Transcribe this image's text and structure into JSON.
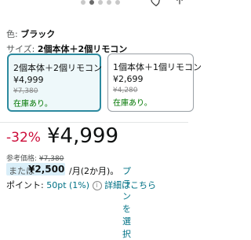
{
  "carousel": {
    "dots": 5,
    "active": 2
  },
  "color": {
    "label": "色:",
    "value": "ブラック"
  },
  "size": {
    "label": "サイズ:",
    "value": "2個本体＋2個リモコン"
  },
  "options": [
    {
      "title": "2個本体＋2個リモコン",
      "price": "¥4,999",
      "original": "¥7,380",
      "stock": "在庫あり。",
      "selected": true
    },
    {
      "title": "1個本体＋1個リモコン",
      "price": "¥2,699",
      "original": "¥4,280",
      "stock": "在庫あり。",
      "selected": false
    }
  ],
  "pricing": {
    "discount": "-32%",
    "yen": "¥",
    "price": "4,999",
    "ref_label": "参考価格:",
    "ref_price": "¥7,380",
    "alt_or": "または",
    "alt_amount": "¥2,500",
    "alt_period": "/月(2か月)。",
    "plan_link": "プランを選択"
  },
  "points": {
    "label": "ポイント:",
    "value": "50pt",
    "pct": "(1%)",
    "details": "詳細はこちら"
  }
}
